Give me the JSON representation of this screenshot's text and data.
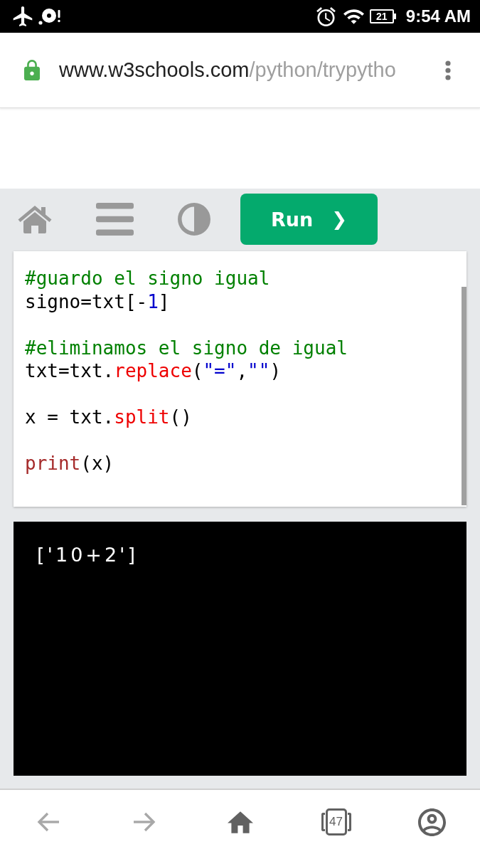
{
  "status_bar": {
    "battery": "21",
    "time": "9:54 AM"
  },
  "address_bar": {
    "host": "www.w3schools.com",
    "path": "/python/trypytho"
  },
  "toolbar": {
    "run_button": {
      "label": "Run",
      "icon": "❯"
    }
  },
  "editor": {
    "lines": [
      {
        "kind": "code",
        "tokens": [
          {
            "kind": "comment",
            "text": "#guardo el signo igual"
          }
        ]
      },
      {
        "kind": "code",
        "tokens": [
          {
            "kind": "plain",
            "text": "signo=txt[-"
          },
          {
            "kind": "number",
            "text": "1"
          },
          {
            "kind": "plain",
            "text": "]"
          }
        ]
      },
      {
        "kind": "blank"
      },
      {
        "kind": "code",
        "tokens": [
          {
            "kind": "comment",
            "text": "#eliminamos el signo de igual"
          }
        ]
      },
      {
        "kind": "code",
        "tokens": [
          {
            "kind": "plain",
            "text": "txt=txt."
          },
          {
            "kind": "method",
            "text": "replace"
          },
          {
            "kind": "plain",
            "text": "("
          },
          {
            "kind": "string",
            "text": "\"=\""
          },
          {
            "kind": "plain",
            "text": ","
          },
          {
            "kind": "string",
            "text": "\"\""
          },
          {
            "kind": "plain",
            "text": ")"
          }
        ]
      },
      {
        "kind": "blank"
      },
      {
        "kind": "code",
        "tokens": [
          {
            "kind": "plain",
            "text": "x = txt."
          },
          {
            "kind": "method",
            "text": "split"
          },
          {
            "kind": "plain",
            "text": "()"
          }
        ]
      },
      {
        "kind": "blank"
      },
      {
        "kind": "code",
        "tokens": [
          {
            "kind": "keyword",
            "text": "print"
          },
          {
            "kind": "plain",
            "text": "(x)"
          }
        ]
      }
    ]
  },
  "output": {
    "lines": [
      "['10+2']"
    ]
  },
  "bottom_nav": [
    {
      "kind": "back",
      "disabled": true
    },
    {
      "kind": "forward",
      "disabled": true
    },
    {
      "kind": "home",
      "disabled": false
    },
    {
      "kind": "tabs",
      "count": "47",
      "disabled": false
    },
    {
      "kind": "account",
      "disabled": false
    }
  ]
}
